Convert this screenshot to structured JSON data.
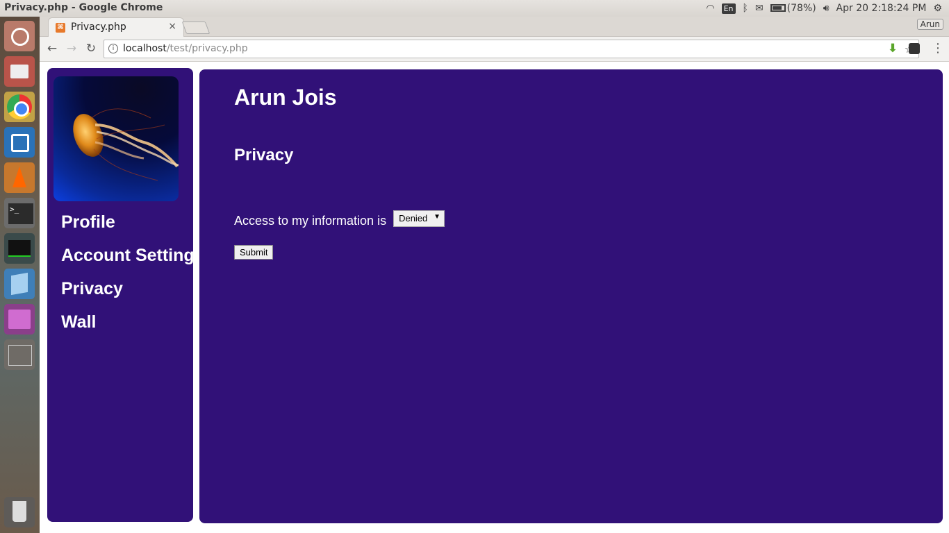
{
  "os": {
    "window_title": "Privacy.php - Google Chrome",
    "tray": {
      "keyboard_layout": "En",
      "battery": "(78%)",
      "datetime": "Apr 20  2:18:24 PM"
    },
    "launcher_icons": [
      "ubuntu-icon",
      "files-icon",
      "chrome-icon",
      "virtualbox-icon",
      "vlc-icon",
      "terminal-icon",
      "system-monitor-icon",
      "box-icon",
      "purple-app-icon",
      "workspace-switcher-icon",
      "trash-icon"
    ]
  },
  "browser": {
    "tab": {
      "title": "Privacy.php",
      "close": "×"
    },
    "profile": "Arun",
    "url": {
      "host": "localhost",
      "path": "/test/privacy.php"
    }
  },
  "page": {
    "sidebar": {
      "items": [
        {
          "label": "Profile"
        },
        {
          "label": "Account Setting"
        },
        {
          "label": "Privacy"
        },
        {
          "label": "Wall"
        }
      ]
    },
    "main": {
      "user_name": "Arun Jois",
      "section_title": "Privacy",
      "access_label": "Access to my information is",
      "access_value": "Denied",
      "submit_label": "Submit"
    },
    "colors": {
      "panel_bg": "#311178",
      "text": "#ffffff"
    }
  }
}
